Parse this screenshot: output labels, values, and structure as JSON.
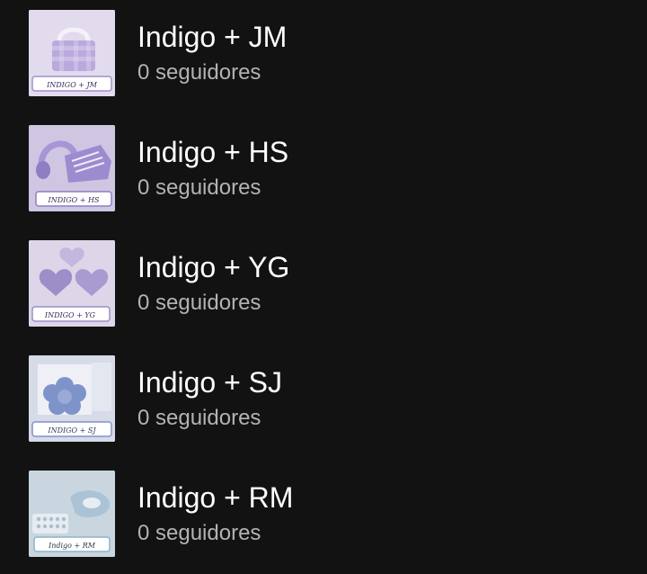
{
  "playlists": [
    {
      "title": "Indigo + JM",
      "followers": "0 seguidores",
      "thumb_label": "INDIGO + JM",
      "thumb_icon": "bag-and-gingham-image",
      "thumb_bg": "#d8cfe9",
      "thumb_accent": "#a18fcf"
    },
    {
      "title": "Indigo + HS",
      "followers": "0 seguidores",
      "thumb_label": "INDIGO + HS",
      "thumb_icon": "headphones-and-sneakers-image",
      "thumb_bg": "#cfc6e2",
      "thumb_accent": "#8f7ec2"
    },
    {
      "title": "Indigo + YG",
      "followers": "0 seguidores",
      "thumb_label": "INDIGO + YG",
      "thumb_icon": "heart-cookies-image",
      "thumb_bg": "#dcd6e8",
      "thumb_accent": "#9c8fc7"
    },
    {
      "title": "Indigo + SJ",
      "followers": "0 seguidores",
      "thumb_label": "INDIGO + SJ",
      "thumb_icon": "blue-flower-box-image",
      "thumb_bg": "#d7dbe8",
      "thumb_accent": "#7d93c9"
    },
    {
      "title": "Indigo + RM",
      "followers": "0 seguidores",
      "thumb_label": "Indigo + RM",
      "thumb_icon": "blue-desk-items-image",
      "thumb_bg": "#c9d6df",
      "thumb_accent": "#8fb2c9"
    }
  ]
}
